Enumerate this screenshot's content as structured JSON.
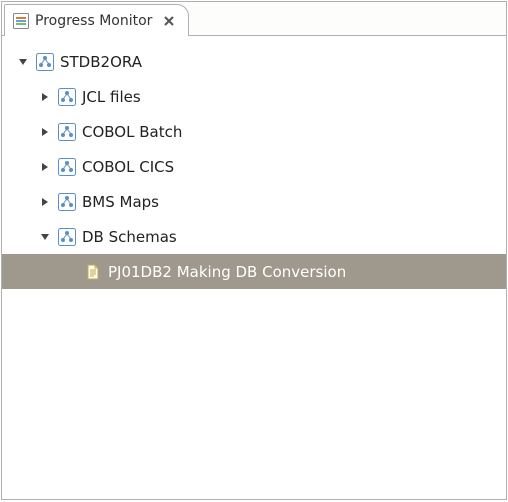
{
  "tab": {
    "title": "Progress Monitor"
  },
  "tree": {
    "root": {
      "label": "STDB2ORA",
      "expanded": true
    },
    "children": [
      {
        "label": "JCL files",
        "expanded": false
      },
      {
        "label": "COBOL Batch",
        "expanded": false
      },
      {
        "label": "COBOL CICS",
        "expanded": false
      },
      {
        "label": "BMS Maps",
        "expanded": false
      },
      {
        "label": "DB Schemas",
        "expanded": true
      }
    ],
    "leaf": {
      "label": "PJ01DB2 Making DB Conversion",
      "selected": true
    }
  }
}
